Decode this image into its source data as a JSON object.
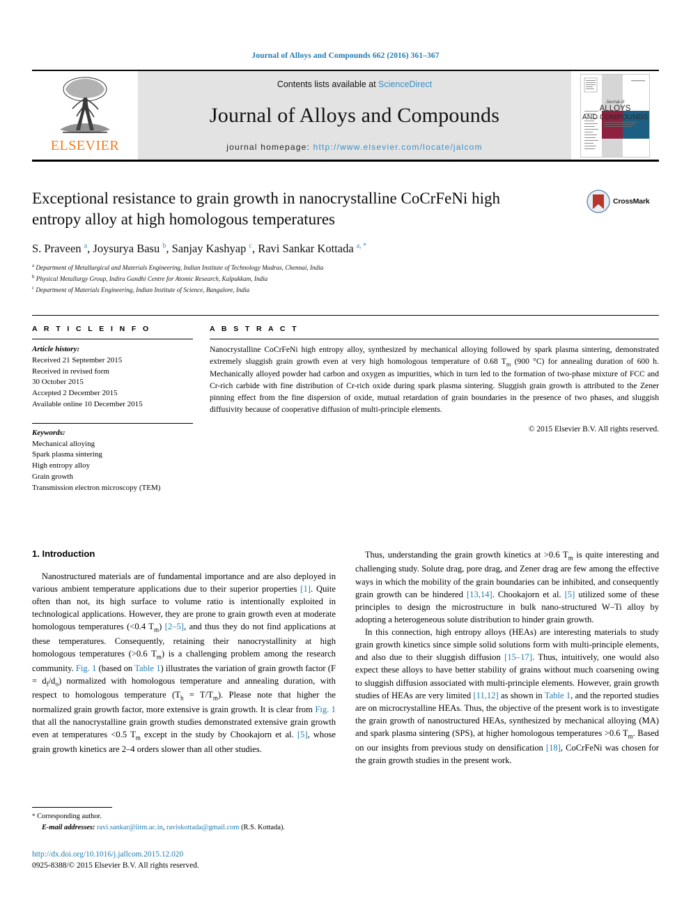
{
  "running_head": "Journal of Alloys and Compounds 662 (2016) 361–367",
  "masthead": {
    "publisher": "ELSEVIER",
    "contents_prefix": "Contents lists available at ",
    "contents_link": "ScienceDirect",
    "journal_name": "Journal of Alloys and Compounds",
    "homepage_prefix": "journal homepage: ",
    "homepage_url": "http://www.elsevier.com/locate/jalcom",
    "cover_lines": [
      "Journal of",
      "ALLOYS",
      "AND COMPOUNDS"
    ]
  },
  "crossmark": {
    "label": "CrossMark"
  },
  "article": {
    "title": "Exceptional resistance to grain growth in nanocrystalline CoCrFeNi high entropy alloy at high homologous temperatures",
    "authors_html": "S. Praveen <sup>a</sup>, Joysurya Basu <sup>b</sup>, Sanjay Kashyap <sup>c</sup>, Ravi Sankar Kottada <sup>a, *</sup>",
    "affiliations": [
      {
        "mark": "a",
        "text": "Department of Metallurgical and Materials Engineering, Indian Institute of Technology Madras, Chennai, India"
      },
      {
        "mark": "b",
        "text": "Physical Metallurgy Group, Indira Gandhi Centre for Atomic Research, Kalpakkam, India"
      },
      {
        "mark": "c",
        "text": "Department of Materials Engineering, Indian Institute of Science, Bangalore, India"
      }
    ]
  },
  "article_info": {
    "heading": "A R T I C L E  I N F O",
    "history_label": "Article history:",
    "history": [
      "Received 21 September 2015",
      "Received in revised form",
      "30 October 2015",
      "Accepted 2 December 2015",
      "Available online 10 December 2015"
    ],
    "keywords_label": "Keywords:",
    "keywords": [
      "Mechanical alloying",
      "Spark plasma sintering",
      "High entropy alloy",
      "Grain growth",
      "Transmission electron microscopy (TEM)"
    ]
  },
  "abstract": {
    "heading": "A B S T R A C T",
    "text_html": "Nanocrystalline CoCrFeNi high entropy alloy, synthesized by mechanical alloying followed by spark plasma sintering, demonstrated extremely sluggish grain growth even at very high homologous temperature of 0.68 T<sub>m</sub> (900 &#176;C) for annealing duration of 600 h. Mechanically alloyed powder had carbon and oxygen as impurities, which in turn led to the formation of two-phase mixture of FCC and Cr-rich carbide with fine distribution of Cr-rich oxide during spark plasma sintering. Sluggish grain growth is attributed to the Zener pinning effect from the fine dispersion of oxide, mutual retardation of grain boundaries in the presence of two phases, and sluggish diffusivity because of cooperative diffusion of multi-principle elements.",
    "copyright": "© 2015 Elsevier B.V. All rights reserved."
  },
  "introduction": {
    "heading": "1. Introduction",
    "left_paragraphs_html": [
      "Nanostructured materials are of fundamental importance and are also deployed in various ambient temperature applications due to their superior properties <span class=\"ref\">[1]</span>. Quite often than not, its high surface to volume ratio is intentionally exploited in technological applications. However, they are prone to grain growth even at moderate homologous temperatures (&lt;0.4 T<sub>m</sub>) <span class=\"ref\">[2–5]</span>, and thus they do not find applications at these temperatures. Consequently, retaining their nanocrystallinity at high homologous temperatures (&gt;0.6 T<sub>m</sub>) is a challenging problem among the research community. <span class=\"ref\">Fig. 1</span> (based on <span class=\"ref\">Table 1</span>) illustrates the variation of grain growth factor (F = d<sub>f</sub>/d<sub>o</sub>) normalized with homologous temperature and annealing duration, with respect to homologous temperature (T<sub>h</sub> = T/T<sub>m</sub>). Please note that higher the normalized grain growth factor, more extensive is grain growth. It is clear from <span class=\"ref\">Fig. 1</span> that all the nanocrystalline grain growth studies demonstrated extensive grain growth even at temperatures &lt;0.5 T<sub>m</sub> except in the study by Chookajorn et al. <span class=\"ref\">[5]</span>, whose grain growth kinetics are 2–4 orders slower than all other studies."
    ],
    "right_paragraphs_html": [
      "Thus, understanding the grain growth kinetics at &gt;0.6 T<sub>m</sub> is quite interesting and challenging study. Solute drag, pore drag, and Zener drag are few among the effective ways in which the mobility of the grain boundaries can be inhibited, and consequently grain growth can be hindered <span class=\"ref\">[13,14]</span>. Chookajorn et al. <span class=\"ref\">[5]</span> utilized some of these principles to design the microstructure in bulk nano-structured W–Ti alloy by adopting a heterogeneous solute distribution to hinder grain growth.",
      "In this connection, high entropy alloys (HEAs) are interesting materials to study grain growth kinetics since simple solid solutions form with multi-principle elements, and also due to their sluggish diffusion <span class=\"ref\">[15–17]</span>. Thus, intuitively, one would also expect these alloys to have better stability of grains without much coarsening owing to sluggish diffusion associated with multi-principle elements. However, grain growth studies of HEAs are very limited <span class=\"ref\">[11,12]</span> as shown in <span class=\"ref\">Table 1</span>, and the reported studies are on microcrystalline HEAs. Thus, the objective of the present work is to investigate the grain growth of nanostructured HEAs, synthesized by mechanical alloying (MA) and spark plasma sintering (SPS), at higher homologous temperatures &gt;0.6 T<sub>m</sub>. Based on our insights from previous study on densification <span class=\"ref\">[18]</span>, CoCrFeNi was chosen for the grain growth studies in the present work."
    ]
  },
  "footnote": {
    "corresponding": "Corresponding author.",
    "email_label": "E-mail addresses:",
    "email1": "ravi.sankar@iitm.ac.in",
    "email2": "raviskottada@gmail.com",
    "email_suffix": "(R.S. Kottada)."
  },
  "bottom": {
    "doi": "http://dx.doi.org/10.1016/j.jallcom.2015.12.020",
    "issn_line": "0925-8388/© 2015 Elsevier B.V. All rights reserved."
  }
}
